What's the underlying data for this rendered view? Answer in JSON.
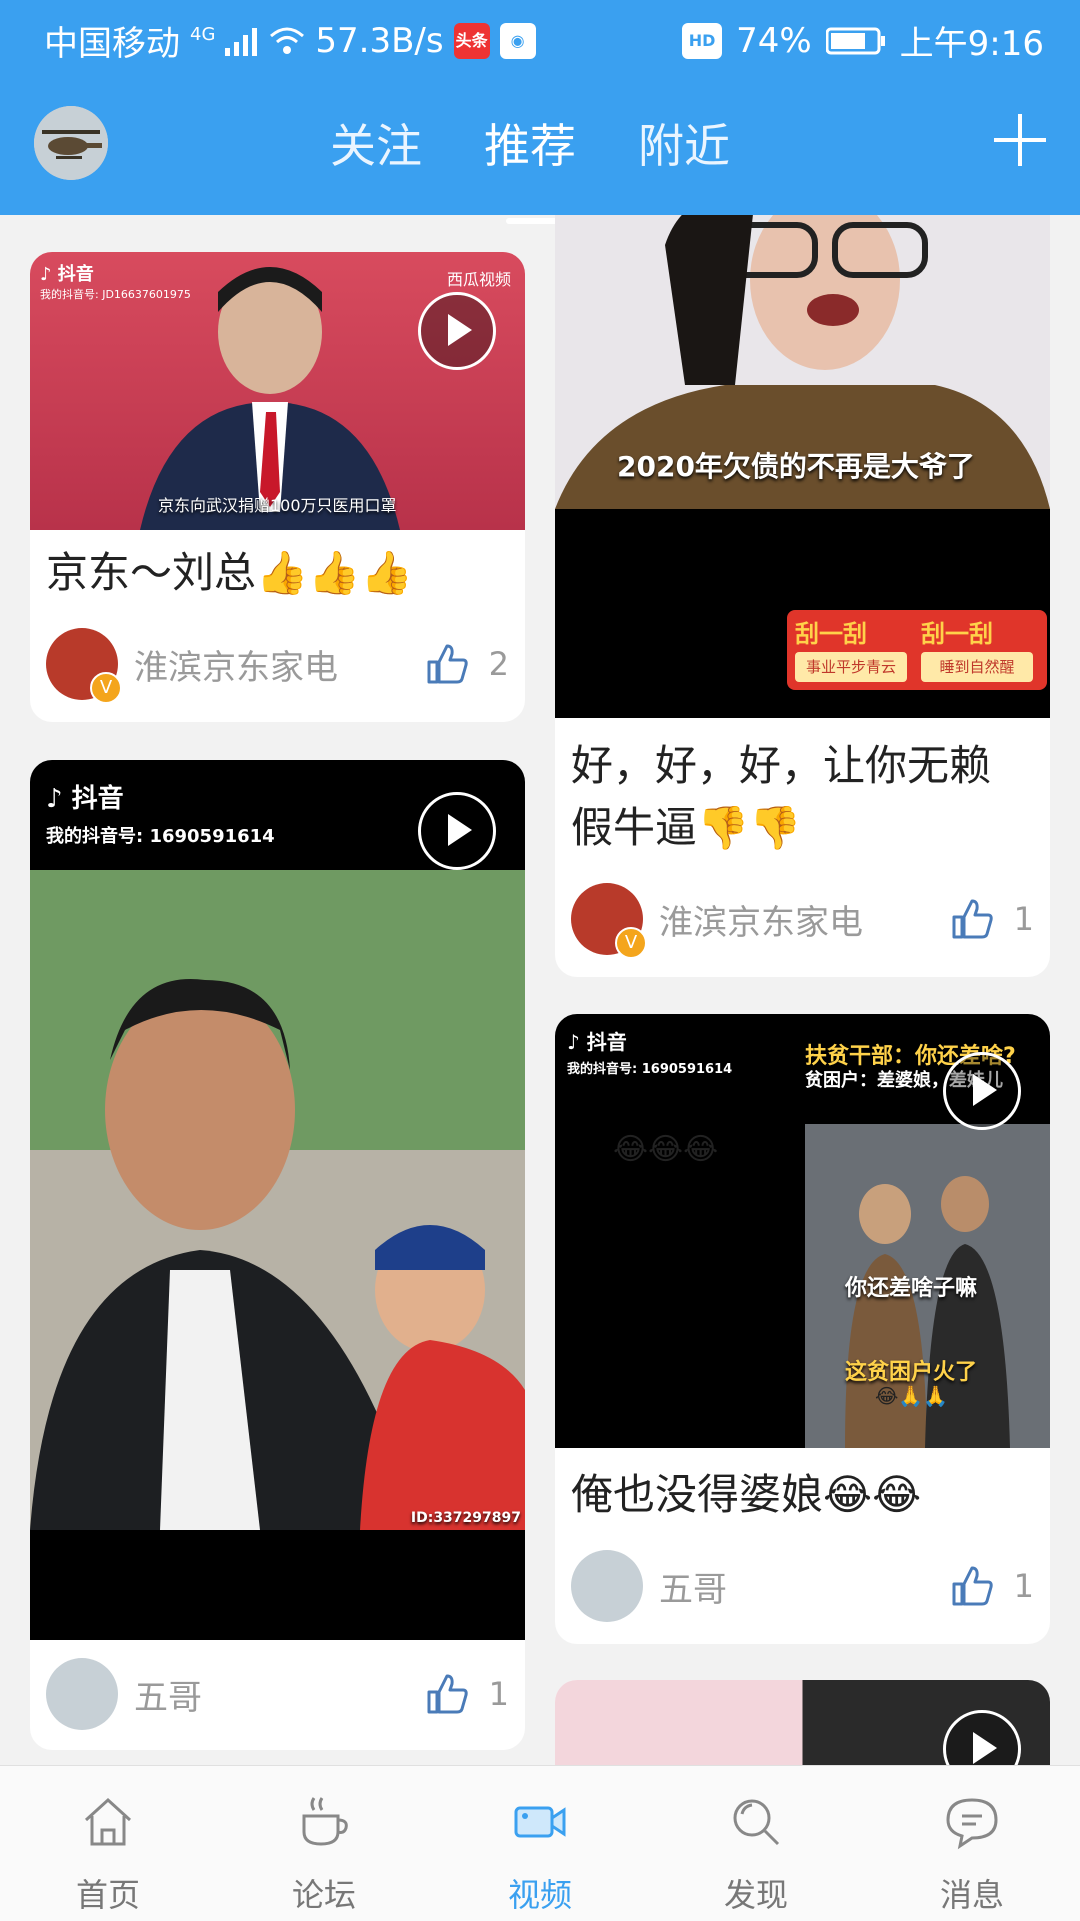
{
  "status_bar": {
    "carrier": "中国移动",
    "network": "4G",
    "speed": "57.3B/s",
    "app_badge_1": "头条",
    "hd": "HD",
    "battery": "74%",
    "time": "上午9:16"
  },
  "nav": {
    "tabs": [
      {
        "label": "关注",
        "active": false
      },
      {
        "label": "推荐",
        "active": true
      },
      {
        "label": "附近",
        "active": false
      }
    ]
  },
  "feed": {
    "cards": [
      {
        "title": "京东～刘总👍👍👍",
        "author": "淮滨京东家电",
        "likes": "2",
        "verified": true,
        "overlay": {
          "brand": "抖音",
          "account": "我的抖音号: JD16637601975",
          "source": "西瓜视频",
          "caption": "京东向武汉捐赠100万只医用口罩"
        }
      },
      {
        "title": "好，好，好，让你无赖假牛逼👎👎",
        "author": "淮滨京东家电",
        "likes": "1",
        "verified": true,
        "overlay": {
          "caption": "2020年欠债的不再是大爷了",
          "scratch_1": "刮一刮",
          "scratch_1_sub": "事业平步青云",
          "scratch_2": "刮一刮",
          "scratch_2_sub": "睡到自然醒"
        }
      },
      {
        "title": "",
        "author": "五哥",
        "likes": "1",
        "verified": false,
        "overlay": {
          "brand": "抖音",
          "account": "我的抖音号: 1690591614",
          "id_tag": "ID:337297897"
        }
      },
      {
        "title": "俺也没得婆娘😂😂",
        "author": "五哥",
        "likes": "1",
        "verified": false,
        "overlay": {
          "brand": "抖音",
          "account": "我的抖音号: 1690591614",
          "emojis": "😂😂😂",
          "line1": "扶贫干部：你还差啥?",
          "line2": "贫困户：差婆娘，差娃儿",
          "caption1": "你还差啥子嘛",
          "caption2": "这贫困户火了",
          "caption2_emojis": "😂🙏🙏"
        }
      }
    ]
  },
  "bottom_nav": {
    "items": [
      {
        "label": "首页",
        "icon": "home-icon",
        "active": false
      },
      {
        "label": "论坛",
        "icon": "cup-icon",
        "active": false
      },
      {
        "label": "视频",
        "icon": "video-icon",
        "active": true
      },
      {
        "label": "发现",
        "icon": "search-icon",
        "active": false
      },
      {
        "label": "消息",
        "icon": "message-icon",
        "active": false
      }
    ]
  },
  "colors": {
    "primary": "#3aa0f0",
    "text_secondary": "#9a9a9a",
    "verified": "#f4a51c"
  }
}
